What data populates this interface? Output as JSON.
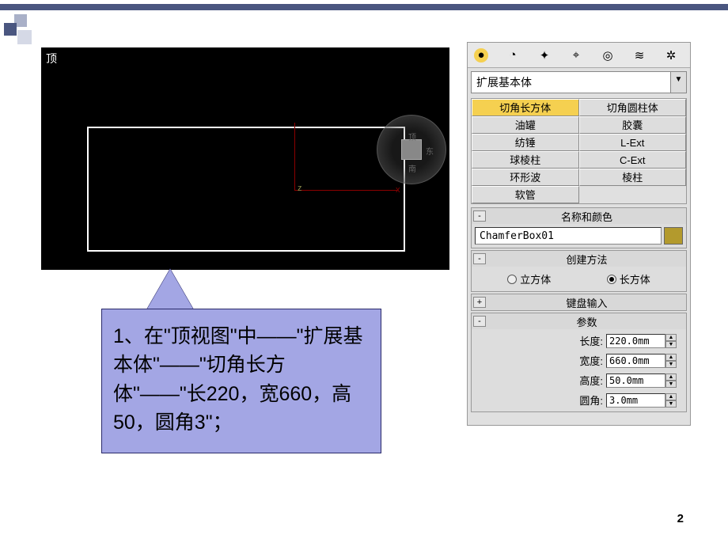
{
  "viewport": {
    "label": "顶",
    "axis_x": "x",
    "axis_z": "z",
    "cube_top": "顶",
    "cube_e": "东",
    "cube_s": "南"
  },
  "callout": {
    "text": "1、在\"顶视图\"中——\"扩展基本体\"——\"切角长方体\"——\"长220，宽660，高50，圆角3\"；"
  },
  "panel": {
    "dropdown": "扩展基本体",
    "buttons": {
      "r0c0": "切角长方体",
      "r0c1": "切角圆柱体",
      "r1c0": "油罐",
      "r1c1": "胶囊",
      "r2c0": "纺锤",
      "r2c1": "L-Ext",
      "r3c0": "球棱柱",
      "r3c1": "C-Ext",
      "r4c0": "环形波",
      "r4c1": "棱柱",
      "r5c0": "软管"
    },
    "rollouts": {
      "name_color": "名称和颜色",
      "create_method": "创建方法",
      "keyboard": "键盘输入",
      "params": "参数"
    },
    "object_name": "ChamferBox01",
    "swatch_color": "#b39a2d",
    "radio_cube": "立方体",
    "radio_box": "长方体",
    "params": {
      "length_label": "长度:",
      "width_label": "宽度:",
      "height_label": "高度:",
      "fillet_label": "圆角:",
      "length": "220.0mm",
      "width": "660.0mm",
      "height": "50.0mm",
      "fillet": "3.0mm"
    }
  },
  "page_number": "2",
  "icons": {
    "sphere": "●",
    "teapot": "◔",
    "wand": "✦",
    "camera": "⌖",
    "light": "◎",
    "waves": "≋",
    "gear": "✲",
    "dd_arrow": "▼",
    "minus": "-",
    "plus": "+",
    "up": "▲",
    "down": "▼"
  }
}
